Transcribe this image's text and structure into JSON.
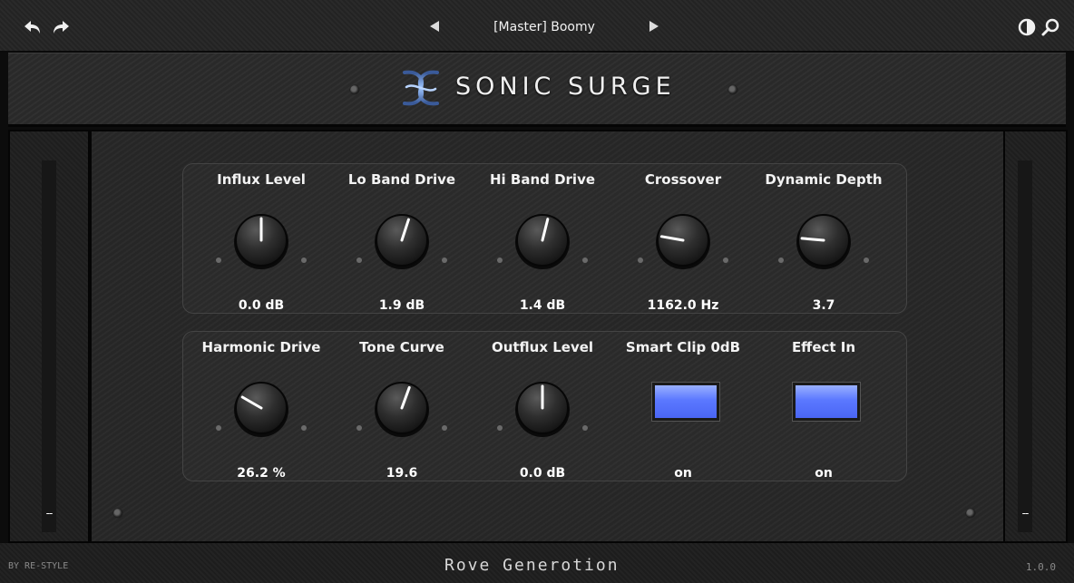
{
  "topbar": {
    "undo_icon": "undo-arrow-icon",
    "redo_icon": "redo-arrow-icon",
    "prev_icon": "triangle-left-icon",
    "next_icon": "triangle-right-icon",
    "preset_name": "[Master] Boomy",
    "contrast_icon": "contrast-icon",
    "search_icon": "search-icon"
  },
  "header": {
    "logo_text": "SONIC SURGE",
    "logo_icon": "swirl-logo-icon"
  },
  "meters": {
    "left_readout": "--",
    "right_readout": "--"
  },
  "row1": [
    {
      "label": "Influx Level",
      "value": "0.0 dB"
    },
    {
      "label": "Lo Band Drive",
      "value": "1.9 dB"
    },
    {
      "label": "Hi Band Drive",
      "value": "1.4 dB"
    },
    {
      "label": "Crossover",
      "value": "1162.0 Hz"
    },
    {
      "label": "Dynamic Depth",
      "value": "3.7"
    }
  ],
  "row2": [
    {
      "label": "Harmonic Drive",
      "value": "26.2 %"
    },
    {
      "label": "Tone Curve",
      "value": "19.6"
    },
    {
      "label": "Outflux Level",
      "value": "0.0 dB"
    },
    {
      "label": "Smart Clip 0dB",
      "value": "on"
    },
    {
      "label": "Effect In",
      "value": "on"
    }
  ],
  "knob_angles_deg": [
    0,
    18,
    14,
    -80,
    -85,
    -60,
    20,
    0
  ],
  "footer": {
    "by": "BY RE-STYLE",
    "brand": "Rove Generotion",
    "version": "1.0.0"
  },
  "colors": {
    "toggle_on": "#5b78ff"
  }
}
